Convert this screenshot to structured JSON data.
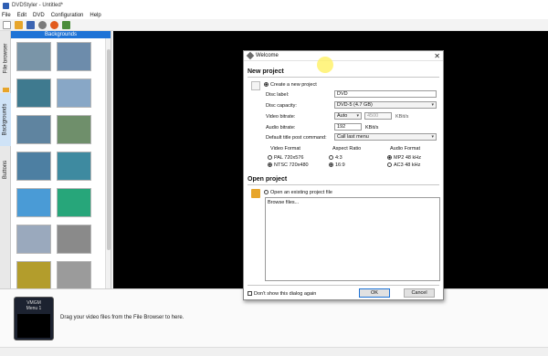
{
  "app": {
    "title": "DVDStyler - Untitled*"
  },
  "menu": [
    "File",
    "Edit",
    "DVD",
    "Configuration",
    "Help"
  ],
  "toolbar": {
    "icons": [
      "new-icon",
      "open-icon",
      "save-icon",
      "settings-icon",
      "burn-icon",
      "dropdown-icon"
    ]
  },
  "sidebar": {
    "tabs": [
      "File browser",
      "Backgrounds",
      "Buttons"
    ],
    "active_tab": "Backgrounds",
    "panel_title": "Backgrounds",
    "thumbnails": [
      {
        "color": "#7a95a8"
      },
      {
        "color": "#6d8cab"
      },
      {
        "color": "#3f7a8f"
      },
      {
        "color": "#88a7c6"
      },
      {
        "color": "#5f84a0"
      },
      {
        "color": "#6f8f6b"
      },
      {
        "color": "#4d7fa2"
      },
      {
        "color": "#3e8aa0"
      },
      {
        "color": "#4a9bd6"
      },
      {
        "color": "#27a67a"
      },
      {
        "color": "#9aa9bd"
      },
      {
        "color": "#8a8a8a"
      },
      {
        "color": "#b39d2c"
      },
      {
        "color": "#9b9b9b"
      }
    ]
  },
  "bottom": {
    "menu_thumb": {
      "vmgm": "VMGM",
      "menu": "Menu 1"
    },
    "hint": "Drag your video files from the File Browser to here."
  },
  "dialog": {
    "title": "Welcome",
    "new_project": {
      "heading": "New project",
      "option_create": "Create a new project",
      "disc_label": {
        "label": "Disc label:",
        "value": "DVD"
      },
      "disc_capacity": {
        "label": "Disc capacity:",
        "value": "DVD-5 (4.7 GB)"
      },
      "video_bitrate": {
        "label": "Video bitrate:",
        "mode": "Auto",
        "value": "4500",
        "unit": "KBit/s"
      },
      "audio_bitrate": {
        "label": "Audio bitrate:",
        "value": "192",
        "unit": "KBit/s"
      },
      "post_command": {
        "label": "Default title post command:",
        "value": "Call last menu"
      },
      "video_format": {
        "heading": "Video Format",
        "options": [
          "PAL 720x576",
          "NTSC 720x480"
        ],
        "selected": 1
      },
      "aspect_ratio": {
        "heading": "Aspect Ratio",
        "options": [
          "4:3",
          "16:9"
        ],
        "selected": 1
      },
      "audio_format": {
        "heading": "Audio Format",
        "options": [
          "MP2 48 kHz",
          "AC3 48 kHz"
        ],
        "selected": 0
      }
    },
    "open_project": {
      "heading": "Open project",
      "option_open": "Open an existing project file",
      "list_items": [
        "Browse files..."
      ]
    },
    "dont_show": "Don't show this dialog again",
    "ok": "OK",
    "cancel": "Cancel"
  }
}
